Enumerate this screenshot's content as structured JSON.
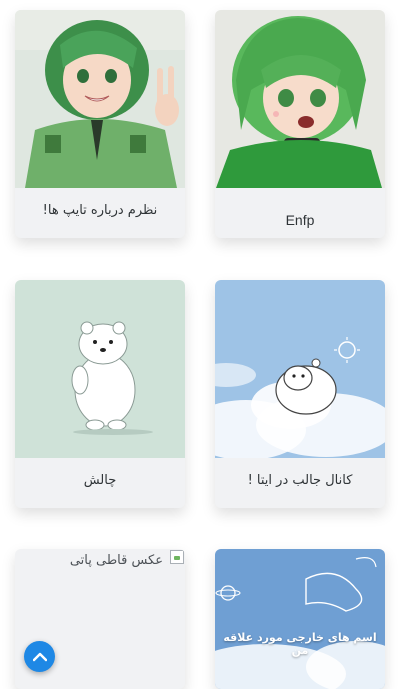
{
  "cards": [
    {
      "title": "نظرم درباره تایپ ها!"
    },
    {
      "title": "Enfp"
    },
    {
      "title": "چالش"
    },
    {
      "title": "کانال جالب در ایتا !"
    },
    {
      "title": "عکس قاطی پاتی"
    },
    {
      "overlay_text": "اسم های خارجی مورد علاقه من"
    }
  ],
  "icons": {
    "scroll_top": "chevron-up-icon",
    "broken_image": "broken-image-icon"
  },
  "colors": {
    "accent": "#1e88e5",
    "card_bg": "#f1f2f4"
  }
}
